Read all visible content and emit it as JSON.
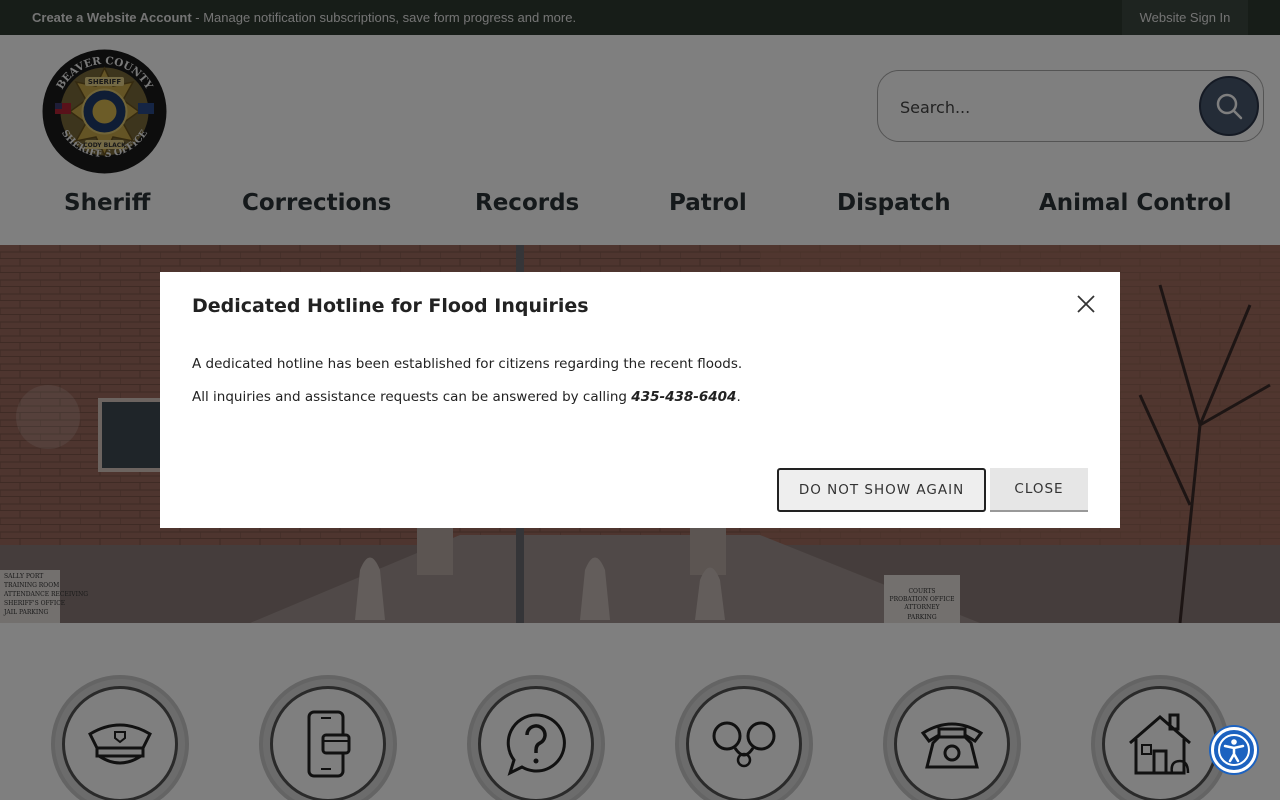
{
  "topbar": {
    "create_account_label": "Create a Website Account",
    "create_account_desc": " - Manage notification subscriptions, save form progress and more.",
    "sign_in_label": "Website Sign In"
  },
  "header": {
    "logo": {
      "text_top": "BEAVER COUNTY",
      "text_bottom": "SHERIFF'S OFFICE",
      "badge_label": "SHERIFF",
      "name": "CODY BLACK"
    },
    "search": {
      "placeholder": "Search..."
    }
  },
  "nav": {
    "items": [
      {
        "label": "Sheriff"
      },
      {
        "label": "Corrections"
      },
      {
        "label": "Records"
      },
      {
        "label": "Patrol"
      },
      {
        "label": "Dispatch"
      },
      {
        "label": "Animal Control"
      }
    ]
  },
  "hero": {
    "sign_left": [
      "SALLY PORT",
      "TRAINING ROOM",
      "ATTENDANCE RECEIVING",
      "SHERIFF'S OFFICE",
      "JAIL PARKING"
    ],
    "sign_right": [
      "COURTS",
      "PROBATION OFFICE",
      "ATTORNEY",
      "PARKING"
    ]
  },
  "quick_links": {
    "icons": [
      "police-hat-icon",
      "mobile-payment-icon",
      "question-bubble-icon",
      "handcuffs-icon",
      "telephone-icon",
      "house-icon"
    ]
  },
  "modal": {
    "title": "Dedicated Hotline for Flood Inquiries",
    "para1": "A dedicated hotline has been established for citizens regarding the recent floods.",
    "para2_before": "All inquiries and assistance requests can be answered by calling ",
    "phone": "435-438-6404",
    "para2_after": ".",
    "dont_show_label": "DO NOT SHOW AGAIN",
    "close_label": "CLOSE"
  },
  "colors": {
    "topbar_bg": "#2f3a30",
    "nav_text": "#2b3336",
    "search_button": "#49596f",
    "accessibility_blue": "#1c62c0"
  }
}
